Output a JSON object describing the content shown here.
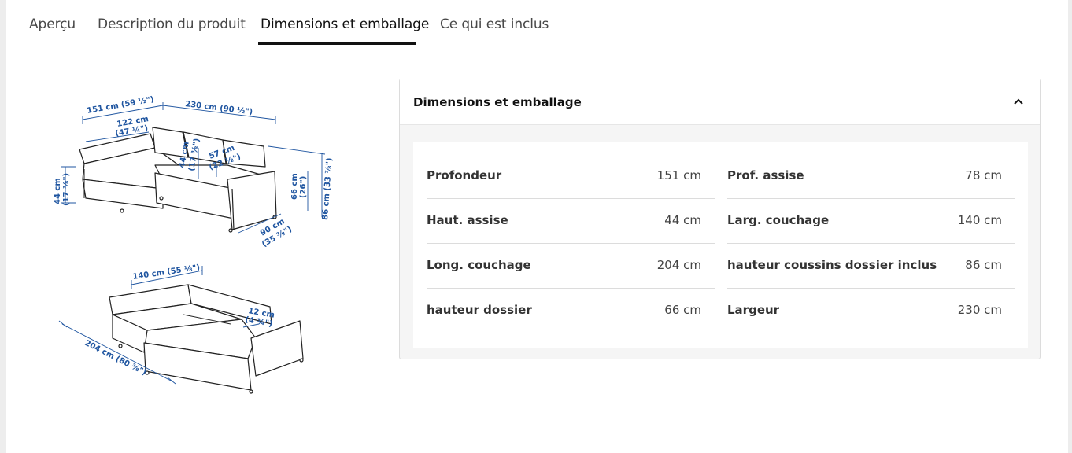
{
  "tabs": [
    {
      "label": "Aperçu"
    },
    {
      "label": "Description du produit"
    },
    {
      "label": "Dimensions et emballage"
    },
    {
      "label": "Ce qui est inclus"
    }
  ],
  "active_tab": "Dimensions et emballage",
  "illustration": {
    "dims": {
      "d151": "151 cm (59 ½\")",
      "d230": "230 cm (90 ½\")",
      "d122a": "122 cm",
      "d122b": "(47 ¼\")",
      "d44a": "44 cm",
      "d44b": "(17 ⅜\")",
      "d44c": "44 cm",
      "d44d": "(17 ⅜\")",
      "d57a": "57 cm",
      "d57b": "(22 ½\")",
      "d66a": "66 cm",
      "d66b": "(26\")",
      "d86": "86 cm (33 ⅞\")",
      "d90a": "90 cm",
      "d90b": "(35 ⅜\")",
      "d140": "140 cm (55 ⅛\")",
      "d12a": "12 cm",
      "d12b": "(4 ¾\")",
      "d204": "204 cm (80 ⅜\")"
    }
  },
  "panel": {
    "title": "Dimensions et emballage",
    "chevron": "chevron-up-icon",
    "left_rows": [
      {
        "label": "Profondeur",
        "value": "151 cm"
      },
      {
        "label": "Haut. assise",
        "value": "44 cm"
      },
      {
        "label": "Long. couchage",
        "value": "204 cm"
      },
      {
        "label": "hauteur dossier",
        "value": "66 cm"
      }
    ],
    "right_rows": [
      {
        "label": "Prof. assise",
        "value": "78 cm"
      },
      {
        "label": "Larg. couchage",
        "value": "140 cm"
      },
      {
        "label": "hauteur coussins dossier inclus",
        "value": "86 cm"
      },
      {
        "label": "Largeur",
        "value": "230 cm"
      }
    ]
  },
  "colors": {
    "dimension_blue": "#1f55a0",
    "tab_active": "#111111"
  }
}
